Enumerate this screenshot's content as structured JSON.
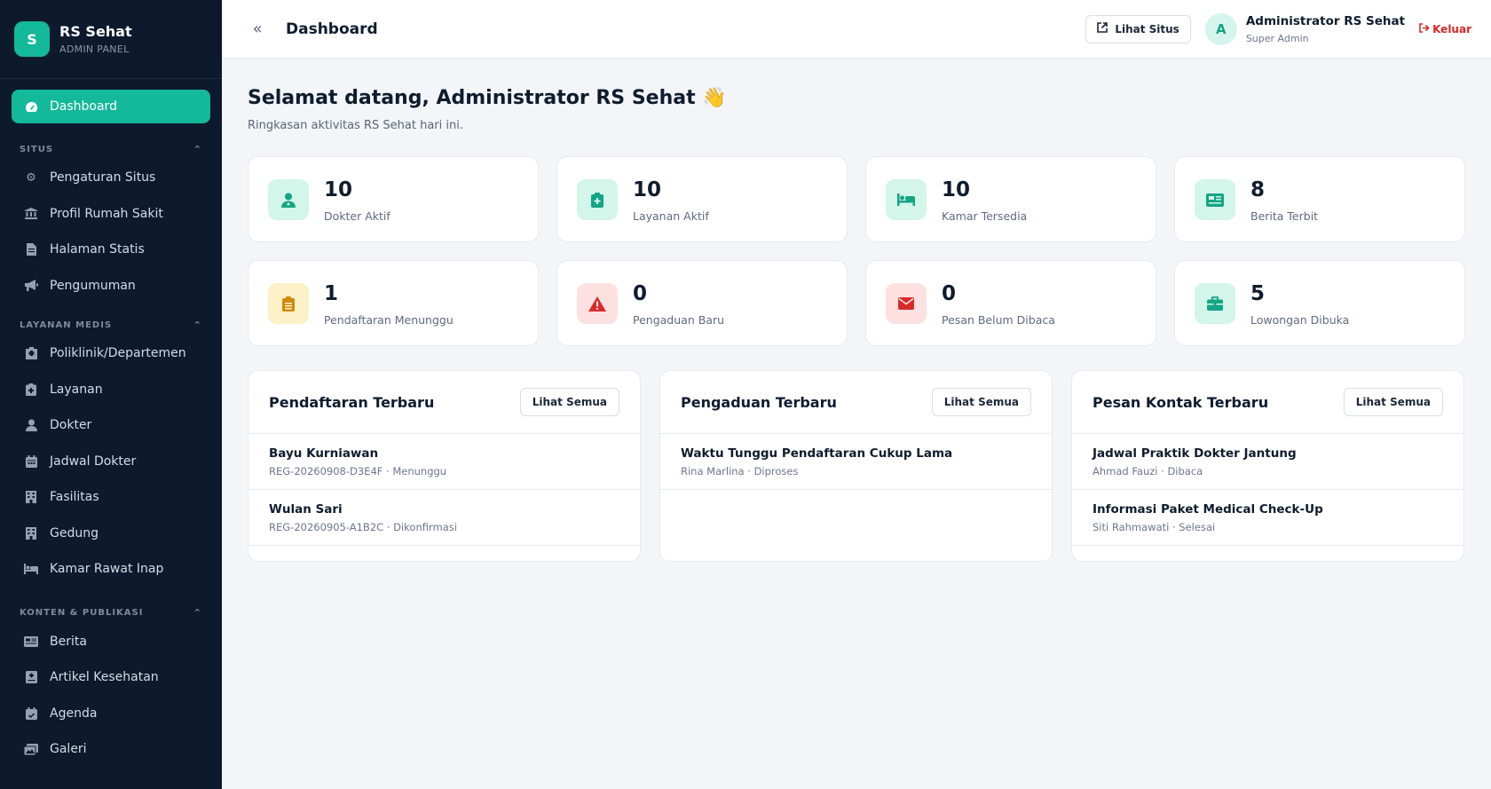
{
  "brand": {
    "logo_letter": "S",
    "name": "RS Sehat",
    "subtitle": "ADMIN PANEL"
  },
  "sidebar": {
    "active": {
      "label": "Dashboard",
      "icon": "gauge-icon"
    },
    "sections": [
      {
        "title": "SITUS",
        "items": [
          {
            "label": "Pengaturan Situs",
            "icon": "gear-icon"
          },
          {
            "label": "Profil Rumah Sakit",
            "icon": "building-columns-icon"
          },
          {
            "label": "Halaman Statis",
            "icon": "file-icon"
          },
          {
            "label": "Pengumuman",
            "icon": "megaphone-icon"
          }
        ]
      },
      {
        "title": "LAYANAN MEDIS",
        "items": [
          {
            "label": "Poliklinik/Departemen",
            "icon": "hospital-icon"
          },
          {
            "label": "Layanan",
            "icon": "clipboard-plus-icon"
          },
          {
            "label": "Dokter",
            "icon": "user-doctor-icon"
          },
          {
            "label": "Jadwal Dokter",
            "icon": "calendar-icon"
          },
          {
            "label": "Fasilitas",
            "icon": "building-icon"
          },
          {
            "label": "Gedung",
            "icon": "building-icon"
          },
          {
            "label": "Kamar Rawat Inap",
            "icon": "bed-icon"
          }
        ]
      },
      {
        "title": "KONTEN & PUBLIKASI",
        "items": [
          {
            "label": "Berita",
            "icon": "newspaper-icon"
          },
          {
            "label": "Artikel Kesehatan",
            "icon": "notes-medical-icon"
          },
          {
            "label": "Agenda",
            "icon": "calendar-check-icon"
          },
          {
            "label": "Galeri",
            "icon": "images-icon"
          }
        ]
      }
    ]
  },
  "topbar": {
    "title": "Dashboard",
    "view_site_label": "Lihat Situs",
    "user": {
      "avatar_letter": "A",
      "name": "Administrator RS Sehat",
      "role": "Super Admin"
    },
    "logout_label": "Keluar"
  },
  "welcome": {
    "title": "Selamat datang, Administrator RS Sehat 👋",
    "subtitle": "Ringkasan aktivitas RS Sehat hari ini."
  },
  "stats": [
    {
      "value": "10",
      "label": "Dokter Aktif",
      "icon": "user-doctor-icon",
      "tone": "green"
    },
    {
      "value": "10",
      "label": "Layanan Aktif",
      "icon": "clipboard-plus-icon",
      "tone": "green"
    },
    {
      "value": "10",
      "label": "Kamar Tersedia",
      "icon": "bed-icon",
      "tone": "green"
    },
    {
      "value": "8",
      "label": "Berita Terbit",
      "icon": "newspaper-icon",
      "tone": "green"
    },
    {
      "value": "1",
      "label": "Pendaftaran Menunggu",
      "icon": "clipboard-list-icon",
      "tone": "amber"
    },
    {
      "value": "0",
      "label": "Pengaduan Baru",
      "icon": "warning-icon",
      "tone": "red"
    },
    {
      "value": "0",
      "label": "Pesan Belum Dibaca",
      "icon": "envelope-icon",
      "tone": "red"
    },
    {
      "value": "5",
      "label": "Lowongan Dibuka",
      "icon": "briefcase-icon",
      "tone": "green"
    }
  ],
  "panels": [
    {
      "title": "Pendaftaran Terbaru",
      "button": "Lihat Semua",
      "rows": [
        {
          "title": "Bayu Kurniawan",
          "sub": "REG-20260908-D3E4F · Menunggu"
        },
        {
          "title": "Wulan Sari",
          "sub": "REG-20260905-A1B2C · Dikonfirmasi"
        }
      ]
    },
    {
      "title": "Pengaduan Terbaru",
      "button": "Lihat Semua",
      "rows": [
        {
          "title": "Waktu Tunggu Pendaftaran Cukup Lama",
          "sub": "Rina Marlina · Diproses"
        }
      ]
    },
    {
      "title": "Pesan Kontak Terbaru",
      "button": "Lihat Semua",
      "rows": [
        {
          "title": "Jadwal Praktik Dokter Jantung",
          "sub": "Ahmad Fauzi · Dibaca"
        },
        {
          "title": "Informasi Paket Medical Check-Up",
          "sub": "Siti Rahmawati · Selesai"
        }
      ]
    }
  ],
  "colors": {
    "accent": "#14b89a",
    "sidebar_bg": "#0d1a2d",
    "danger": "#dc2626",
    "warning": "#d08a07"
  }
}
